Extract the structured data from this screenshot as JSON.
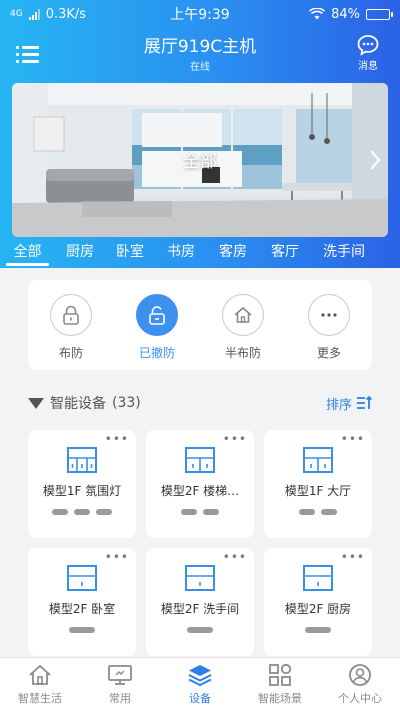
{
  "status_bar": {
    "network": "4G",
    "speed": "0.3K/s",
    "time": "上午9:39",
    "battery": "84%",
    "battery_level": 0.84
  },
  "header": {
    "title": "展厅919C主机",
    "subtitle": "在线",
    "message_label": "消息"
  },
  "banner": {
    "label": "全部"
  },
  "room_tabs": [
    {
      "label": "全部",
      "active": true
    },
    {
      "label": "厨房"
    },
    {
      "label": "卧室"
    },
    {
      "label": "书房"
    },
    {
      "label": "客房"
    },
    {
      "label": "客厅"
    },
    {
      "label": "洗手间"
    }
  ],
  "security": {
    "items": [
      {
        "label": "布防",
        "icon": "lock-icon"
      },
      {
        "label": "已撤防",
        "icon": "unlock-icon",
        "active": true
      },
      {
        "label": "半布防",
        "icon": "home-icon"
      },
      {
        "label": "更多",
        "icon": "more-icon"
      }
    ]
  },
  "devices": {
    "title": "智能设备",
    "count": "(33)",
    "sort_label": "排序",
    "items": [
      {
        "name": "模型1F 氛围灯",
        "switches": 3
      },
      {
        "name": "模型2F 楼梯…",
        "switches": 2
      },
      {
        "name": "模型1F 大厅",
        "switches": 2
      },
      {
        "name": "模型2F 卧室",
        "switches": 1
      },
      {
        "name": "模型2F 洗手间",
        "switches": 1
      },
      {
        "name": "模型2F 厨房",
        "switches": 1
      }
    ]
  },
  "bottom_nav": [
    {
      "label": "智慧生活",
      "icon": "home-icon"
    },
    {
      "label": "常用",
      "icon": "monitor-icon"
    },
    {
      "label": "设备",
      "icon": "layers-icon",
      "active": true
    },
    {
      "label": "智能场景",
      "icon": "grid-icon"
    },
    {
      "label": "个人中心",
      "icon": "user-icon"
    }
  ],
  "colors": {
    "accent": "#2f7fe8",
    "header_start": "#27b5f2",
    "header_end": "#2b62e6"
  }
}
